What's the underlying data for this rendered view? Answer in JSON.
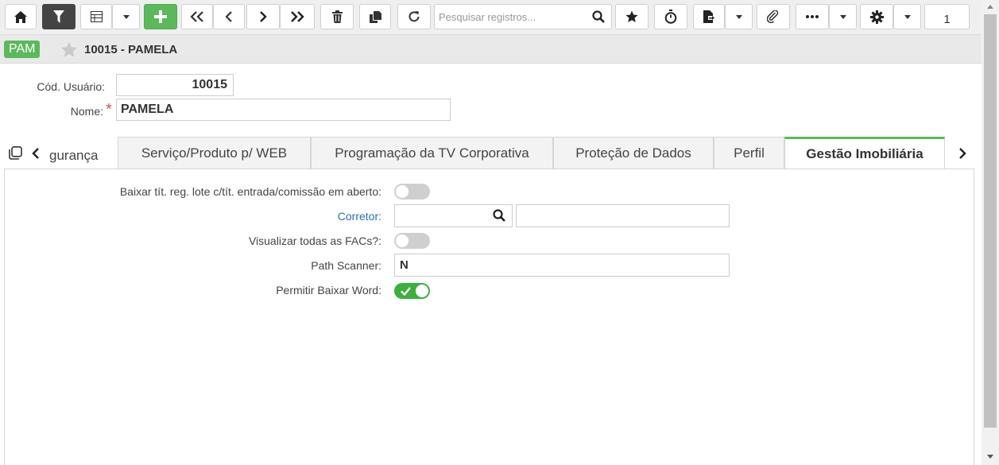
{
  "toolbar": {
    "search_placeholder": "Pesquisar registros...",
    "page_number": "1",
    "icons": [
      "home-icon",
      "filter-icon",
      "grid-icon",
      "add-icon",
      "first-icon",
      "prev-icon",
      "next-icon",
      "last-icon",
      "trash-icon",
      "copy-icon",
      "refresh-icon",
      "search-icon",
      "star-icon",
      "timer-icon",
      "export-icon",
      "paperclip-icon",
      "more-icon",
      "gear-icon"
    ]
  },
  "header": {
    "badge": "PAM",
    "title": "10015 - PAMELA"
  },
  "form": {
    "cod_label": "Cód. Usuário:",
    "cod_value": "10015",
    "nome_label": "Nome:",
    "nome_required": "*",
    "nome_value": "PAMELA"
  },
  "tabs": {
    "partial": "gurança",
    "items": [
      {
        "label": "Serviço/Produto p/ WEB"
      },
      {
        "label": "Programação da TV Corporativa"
      },
      {
        "label": "Proteção de Dados"
      },
      {
        "label": "Perfil"
      },
      {
        "label": "Gestão Imobiliária"
      }
    ],
    "active_index": 4
  },
  "panel": {
    "baixar_label": "Baixar tít. reg. lote c/tít. entrada/comissão em aberto:",
    "baixar_on": false,
    "corretor_label": "Corretor:",
    "corretor_code": "",
    "corretor_name": "",
    "facs_label": "Visualizar todas as FACs?:",
    "facs_on": false,
    "path_label": "Path Scanner:",
    "path_value": "N",
    "word_label": "Permitir Baixar Word:",
    "word_on": true
  },
  "colors": {
    "accent_green": "#5cb85c",
    "link_blue": "#2a6ebb",
    "required_red": "#d9534f"
  }
}
